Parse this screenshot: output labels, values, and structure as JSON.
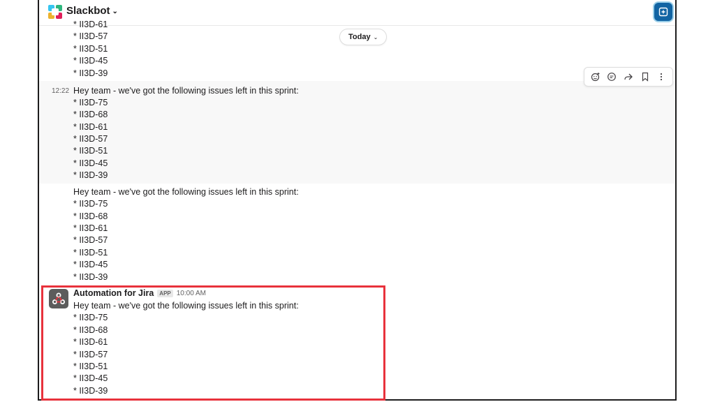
{
  "header": {
    "title": "Slackbot"
  },
  "divider": {
    "label": "Today"
  },
  "messages": {
    "partial_top": [
      "* II3D-61",
      "* II3D-57",
      "* II3D-51",
      "* II3D-45",
      "* II3D-39"
    ],
    "msg1": {
      "time": "12:22",
      "text": "Hey team - we've got the following issues left in this sprint:",
      "items": [
        "* II3D-75",
        "* II3D-68",
        "* II3D-61",
        "* II3D-57",
        "* II3D-51",
        "* II3D-45",
        "* II3D-39"
      ]
    },
    "msg2": {
      "text": "Hey team - we've got the following issues left in this sprint:",
      "items": [
        "* II3D-75",
        "* II3D-68",
        "* II3D-61",
        "* II3D-57",
        "* II3D-51",
        "* II3D-45",
        "* II3D-39"
      ]
    },
    "msg3": {
      "sender": "Automation for Jira",
      "badge": "APP",
      "time": "10:00 AM",
      "text": "Hey team - we've got the following issues left in this sprint:",
      "items": [
        "* II3D-75",
        "* II3D-68",
        "* II3D-61",
        "* II3D-57",
        "* II3D-51",
        "* II3D-45",
        "* II3D-39"
      ]
    }
  }
}
